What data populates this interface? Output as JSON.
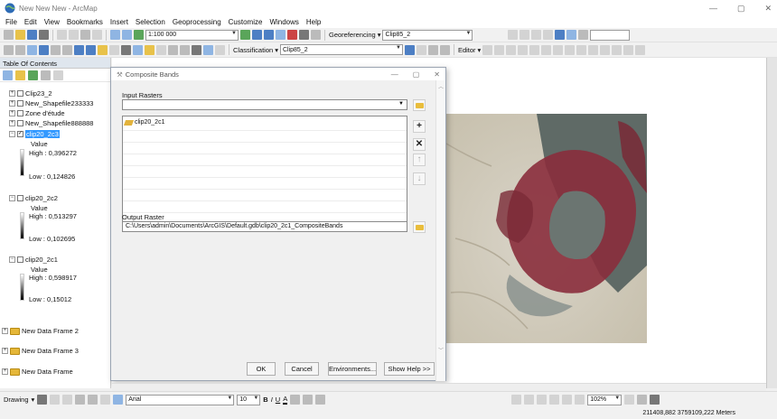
{
  "window": {
    "title": "New New New - ArcMap",
    "controls": {
      "minimize": "—",
      "maximize": "▢",
      "close": "✕"
    }
  },
  "menu": [
    "File",
    "Edit",
    "View",
    "Bookmarks",
    "Insert",
    "Selection",
    "Geoprocessing",
    "Customize",
    "Windows",
    "Help"
  ],
  "toolbar1": {
    "scale": "1:100 000",
    "georeferencing_label": "Georeferencing",
    "georef_layer": "Clip85_2"
  },
  "toolbar2": {
    "classification_label": "Classification",
    "class_layer": "Clip85_2",
    "editor_label": "Editor"
  },
  "toc": {
    "header": "Table Of Contents",
    "layers": [
      {
        "name": "Clip23_2",
        "checked": false
      },
      {
        "name": "New_Shapefile233333",
        "checked": false
      },
      {
        "name": "Zone d'étude",
        "checked": false
      },
      {
        "name": "New_Shapefile888888",
        "checked": false
      },
      {
        "name": "clip20_2c3",
        "checked": true,
        "selected": true,
        "value_label": "Value",
        "high": "High : 0,396272",
        "low": "Low : 0,124826"
      },
      {
        "name": "clip20_2c2",
        "checked": false,
        "value_label": "Value",
        "high": "High : 0,513297",
        "low": "Low : 0,102695"
      },
      {
        "name": "clip20_2c1",
        "checked": false,
        "value_label": "Value",
        "high": "High : 0,598917",
        "low": "Low : 0,15012"
      }
    ],
    "frames": [
      "New Data Frame 2",
      "New Data Frame 3",
      "New Data Frame"
    ]
  },
  "dialog": {
    "title": "Composite Bands",
    "controls": {
      "minimize": "—",
      "maximize": "▢",
      "close": "✕"
    },
    "input_label": "Input Rasters",
    "input_value": "",
    "list_items": [
      "clip20_2c1"
    ],
    "side_buttons": {
      "add": "+",
      "remove": "✕",
      "up": "↑",
      "down": "↓"
    },
    "output_label": "Output Raster",
    "output_value": "C:\\Users\\admin\\Documents\\ArcGIS\\Default.gdb\\clip20_2c1_CompositeBands",
    "buttons": {
      "ok": "OK",
      "cancel": "Cancel",
      "environments": "Environments...",
      "help": "Show Help >>"
    }
  },
  "drawing": {
    "label": "Drawing",
    "font": "Arial",
    "font_size": "10",
    "bold": "B",
    "italic": "I",
    "underline": "U",
    "text_color": "A",
    "zoom": "102%"
  },
  "status": {
    "coordinates": "211408,882  3759109,222 Meters"
  }
}
